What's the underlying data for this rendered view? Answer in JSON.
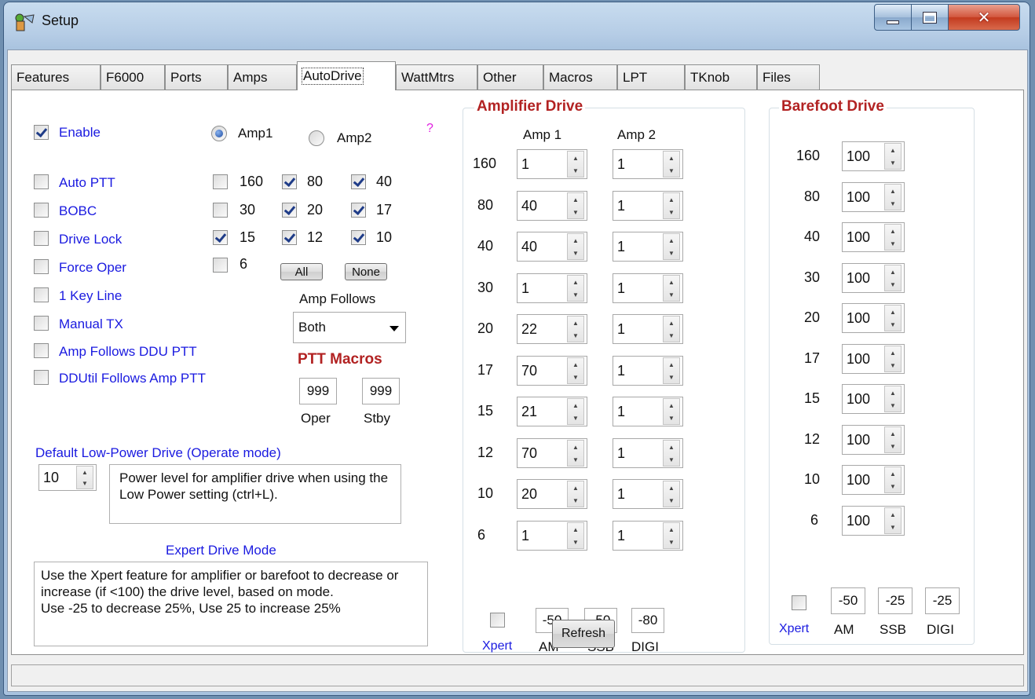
{
  "window": {
    "title": "Setup"
  },
  "tabs": [
    "Features",
    "F6000",
    "Ports",
    "Amps",
    "AutoDrive",
    "WattMtrs",
    "Other",
    "Macros",
    "LPT",
    "TKnob",
    "Files"
  ],
  "active_tab": "AutoDrive",
  "left": {
    "enable": {
      "label": "Enable",
      "checked": true
    },
    "options": [
      {
        "label": "Auto PTT",
        "checked": false
      },
      {
        "label": "BOBC",
        "checked": false
      },
      {
        "label": "Drive Lock",
        "checked": false
      },
      {
        "label": "Force Oper",
        "checked": false
      },
      {
        "label": "1 Key Line",
        "checked": false
      },
      {
        "label": "Manual  TX",
        "checked": false
      },
      {
        "label": "Amp Follows DDU PTT",
        "checked": false
      },
      {
        "label": "DDUtil Follows Amp PTT",
        "checked": false
      }
    ],
    "amp_radio": [
      {
        "label": "Amp1",
        "checked": true
      },
      {
        "label": "Amp2",
        "checked": false
      }
    ],
    "help_mark": "?",
    "bands": [
      {
        "label": "160",
        "checked": false
      },
      {
        "label": "80",
        "checked": true
      },
      {
        "label": "40",
        "checked": true
      },
      {
        "label": "30",
        "checked": false
      },
      {
        "label": "20",
        "checked": true
      },
      {
        "label": "17",
        "checked": true
      },
      {
        "label": "15",
        "checked": true
      },
      {
        "label": "12",
        "checked": true
      },
      {
        "label": "10",
        "checked": true
      },
      {
        "label": "6",
        "checked": false
      }
    ],
    "all_button": "All",
    "none_button": "None",
    "amp_follows_label": "Amp Follows",
    "amp_follows_value": "Both",
    "ptt_macros_title": "PTT Macros",
    "ptt_oper_value": "999",
    "ptt_stby_value": "999",
    "oper_label": "Oper",
    "stby_label": "Stby",
    "low_power_title": "Default Low-Power Drive (Operate mode)",
    "low_power_value": "10",
    "low_power_desc": "Power level for amplifier drive when using the Low Power  setting (ctrl+L).",
    "expert_title": "Expert Drive Mode",
    "expert_desc_1": "Use the Xpert feature for amplifier or barefoot to decrease or increase (if <100) the drive level, based on mode.",
    "expert_desc_2": "Use -25 to decrease 25%, Use  25 to increase 25%"
  },
  "amplifier_drive": {
    "title": "Amplifier Drive",
    "col1": "Amp 1",
    "col2": "Amp 2",
    "rows": [
      {
        "band": "160",
        "amp1": "1",
        "amp2": "1"
      },
      {
        "band": "80",
        "amp1": "40",
        "amp2": "1"
      },
      {
        "band": "40",
        "amp1": "40",
        "amp2": "1"
      },
      {
        "band": "30",
        "amp1": "1",
        "amp2": "1"
      },
      {
        "band": "20",
        "amp1": "22",
        "amp2": "1"
      },
      {
        "band": "17",
        "amp1": "70",
        "amp2": "1"
      },
      {
        "band": "15",
        "amp1": "21",
        "amp2": "1"
      },
      {
        "band": "12",
        "amp1": "70",
        "amp2": "1"
      },
      {
        "band": "10",
        "amp1": "20",
        "amp2": "1"
      },
      {
        "band": "6",
        "amp1": "1",
        "amp2": "1"
      }
    ],
    "xpert_checked": false,
    "xpert_label": "Xpert",
    "am_value": "-50",
    "ssb_value": "-50",
    "digi_value": "-80",
    "am_label": "AM",
    "ssb_label": "SSB",
    "digi_label": "DIGI",
    "refresh_button": "Refresh"
  },
  "barefoot_drive": {
    "title": "Barefoot Drive",
    "rows": [
      {
        "band": "160",
        "value": "100"
      },
      {
        "band": "80",
        "value": "100"
      },
      {
        "band": "40",
        "value": "100"
      },
      {
        "band": "30",
        "value": "100"
      },
      {
        "band": "20",
        "value": "100"
      },
      {
        "band": "17",
        "value": "100"
      },
      {
        "band": "15",
        "value": "100"
      },
      {
        "band": "12",
        "value": "100"
      },
      {
        "band": "10",
        "value": "100"
      },
      {
        "band": "6",
        "value": "100"
      }
    ],
    "xpert_checked": false,
    "xpert_label": "Xpert",
    "am_value": "-50",
    "ssb_value": "-25",
    "digi_value": "-25",
    "am_label": "AM",
    "ssb_label": "SSB",
    "digi_label": "DIGI"
  }
}
